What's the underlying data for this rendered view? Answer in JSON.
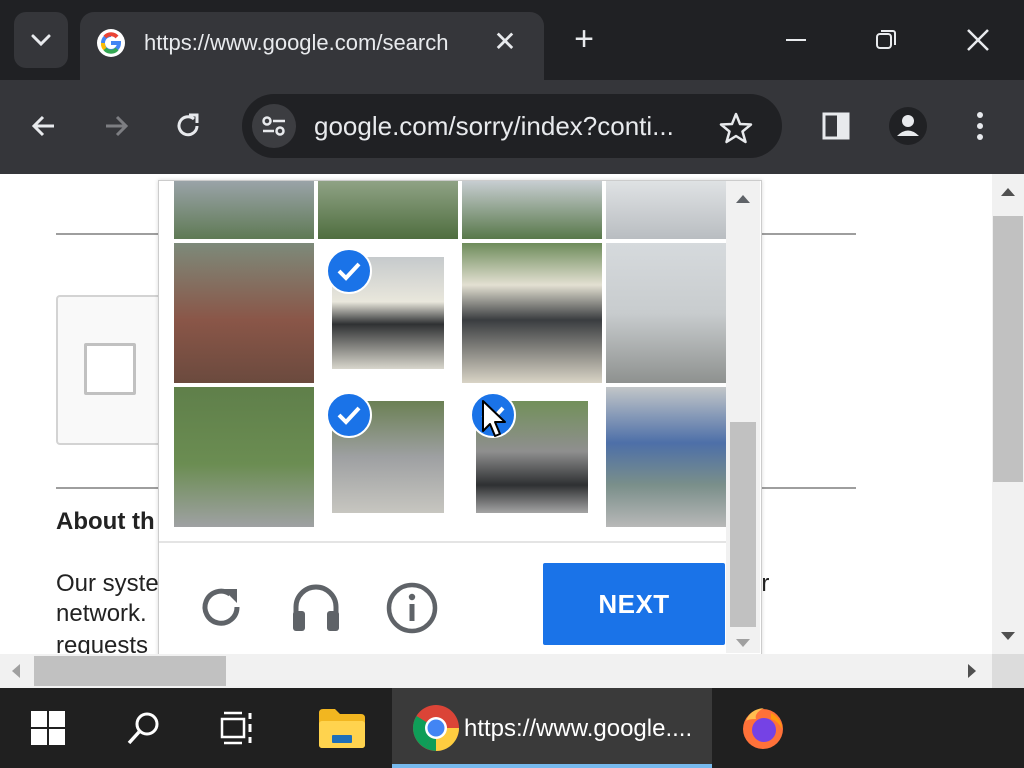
{
  "browser": {
    "tab": {
      "title": "https://www.google.com/search",
      "favicon": "google-g-icon",
      "close_icon": "close-icon"
    },
    "new_tab_icon": "plus-icon",
    "window_controls": [
      "minimize-icon",
      "restore-icon",
      "close-icon"
    ],
    "toolbar": {
      "back_icon": "arrow-left-icon",
      "forward_icon": "arrow-right-icon",
      "reload_icon": "reload-icon",
      "site_info_icon": "tune-icon",
      "url": "google.com/sorry/index?conti...",
      "bookmark_icon": "star-icon",
      "side_panel_icon": "side-panel-icon",
      "profile_icon": "profile-icon",
      "menu_icon": "kebab-menu-icon"
    }
  },
  "page": {
    "about_title": "About th",
    "body_lines": [
      "Our syste",
      "network.",
      "requests"
    ],
    "body_right_fragment": "er"
  },
  "challenge": {
    "grid_rows_visible": 3,
    "grid_cols": 4,
    "selected_tiles": [
      [
        1,
        1
      ],
      [
        2,
        1
      ],
      [
        2,
        2
      ]
    ],
    "controls": {
      "reload_icon": "reload-icon",
      "audio_icon": "headphones-icon",
      "info_icon": "info-icon"
    },
    "next_label": "NEXT"
  },
  "taskbar": {
    "start_icon": "windows-start-icon",
    "search_icon": "search-icon",
    "task_view_icon": "task-view-icon",
    "explorer_icon": "file-explorer-icon",
    "chrome_label": "https://www.google....",
    "firefox_icon": "firefox-icon"
  },
  "colors": {
    "accent": "#1a73e8",
    "chrome_dark": "#202124",
    "toolbar": "#35363a",
    "taskbar": "#202020"
  }
}
